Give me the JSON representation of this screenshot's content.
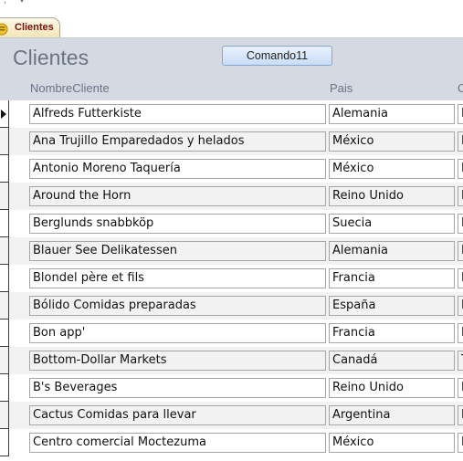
{
  "tab": {
    "label": "Clientes"
  },
  "form": {
    "title": "Clientes",
    "command_button": "Comando11",
    "columns": [
      "NombreCliente",
      "Pais",
      "C"
    ]
  },
  "rows": [
    {
      "nombre": "Alfreds Futterkiste",
      "pais": "Alemania",
      "ciudad": "B"
    },
    {
      "nombre": "Ana Trujillo Emparedados y helados",
      "pais": "México",
      "ciudad": "M"
    },
    {
      "nombre": "Antonio Moreno Taquería",
      "pais": "México",
      "ciudad": "M"
    },
    {
      "nombre": "Around the Horn",
      "pais": "Reino Unido",
      "ciudad": "L"
    },
    {
      "nombre": "Berglunds snabbköp",
      "pais": "Suecia",
      "ciudad": "L"
    },
    {
      "nombre": "Blauer See Delikatessen",
      "pais": "Alemania",
      "ciudad": "H"
    },
    {
      "nombre": "Blondel père et fils",
      "pais": "Francia",
      "ciudad": "E"
    },
    {
      "nombre": "Bólido Comidas preparadas",
      "pais": "España",
      "ciudad": "M"
    },
    {
      "nombre": "Bon app'",
      "pais": "Francia",
      "ciudad": "M"
    },
    {
      "nombre": "Bottom-Dollar Markets",
      "pais": "Canadá",
      "ciudad": "T"
    },
    {
      "nombre": "B's Beverages",
      "pais": "Reino Unido",
      "ciudad": "L"
    },
    {
      "nombre": "Cactus Comidas para llevar",
      "pais": "Argentina",
      "ciudad": "B"
    },
    {
      "nombre": "Centro comercial Moctezuma",
      "pais": "México",
      "ciudad": "M"
    }
  ],
  "colors": {
    "header_bg": "#d5d9e1",
    "title": "#6a7484",
    "alt_row": "#f2f2f2"
  }
}
